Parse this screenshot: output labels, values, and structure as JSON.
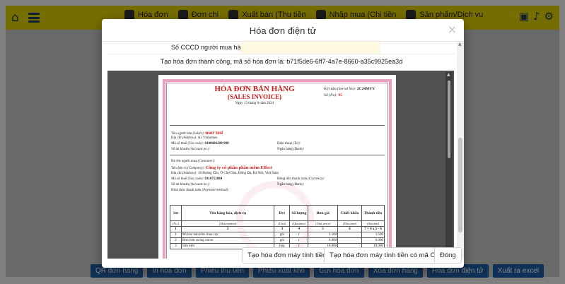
{
  "app": {
    "nav": [
      {
        "label": "Hóa đơn"
      },
      {
        "label": "Đơn chi"
      },
      {
        "label": "Xuất bán (Thu tiền"
      },
      {
        "label": "Nhập mua (Chi tiền"
      },
      {
        "label": "Sản phẩm/Dịch vụ"
      }
    ],
    "bottom_buttons": [
      "QR đơn hàng",
      "In hóa đơn",
      "Phiếu thu tiền",
      "Phiếu xuất kho",
      "Gửi hóa đơn",
      "Xóa đơn hàng",
      "Hóa đơn điện tử",
      "Xuất ra excel"
    ]
  },
  "modal": {
    "title": "Hóa đơn điện tử",
    "close": "×",
    "cccd_label": "Số CCCD người mua hàng",
    "cccd_value": "",
    "success_message": "Tạo hóa đơn thành công, mã số hóa đơn là: b71f5de6-6ff7-4a7e-8660-a35c9925ea3d",
    "buttons": {
      "create": "Tạo hóa đơn máy tính tiền",
      "create_cqt": "Tạo hóa đơn máy tính tiền có mã CQT",
      "close": "Đóng"
    }
  },
  "invoice": {
    "title": "HÓA ĐƠN BÁN HÀNG",
    "subtitle": "(SALES INVOICE)",
    "date": "Ngày 13 tháng 8 năm 2024",
    "serial_label": "Ký hiệu",
    "serial_label_en": "(Serial No):",
    "serial": "2C24MVY",
    "no_label": "Số",
    "no_label_en": "(No):",
    "no": "95",
    "seller": {
      "name_label": "Tên người bán",
      "name_label_en": "(Seller):",
      "name": "user test",
      "address_label": "Địa chỉ",
      "address_label_en": "(Address):",
      "address": "A3 Vinhomes",
      "tax_label": "Mã số thuế",
      "tax_label_en": "(Tax code):",
      "tax": "0100686209-998",
      "phone_label": "Điện thoại",
      "phone_label_en": "(Tel):",
      "account_label": "Số tài khoản",
      "account_label_en": "(Account no.):",
      "bank_label": "Ngân hàng",
      "bank_label_en": "(Bank):"
    },
    "buyer": {
      "customer_label": "Họ tên người mua",
      "customer_label_en": "(Customer):",
      "company_label": "Tên đơn vị",
      "company_label_en": "(Company):",
      "company": "Công ty cổ phần phần mềm Effect",
      "address_label": "Địa chỉ",
      "address_label_en": "(Address):",
      "address": "36 Hoàng Cầu, Ô Chợ Dừa, Đống Đa, Hà Nội, Việt Nam",
      "tax_label": "Mã số thuế",
      "tax_label_en": "(Tax code):",
      "tax": "0110752884",
      "currency_label": "Đồng tiền thanh toán",
      "currency_label_en": "(Currency):",
      "account_label": "Số tài khoản",
      "account_label_en": "(Account no.):",
      "bank_label": "Ngân hàng",
      "bank_label_en": "(Bank):",
      "payment_label": "Hình thức thanh toán",
      "payment_label_en": "(Payment method):"
    },
    "table": {
      "headers": [
        "Stt",
        "Tên hàng hóa, dịch vụ",
        "Đvt",
        "Số lượng",
        "Đơn giá",
        "Chiết khấu",
        "Thành tiền"
      ],
      "subheaders": [
        "(No.)",
        "(Description)",
        "(Unit)",
        "(Quantity)",
        "(Unit price)",
        "(Discount)",
        "(Amount)"
      ],
      "index_row": [
        "1",
        "2",
        "3",
        "4",
        "5",
        "6",
        "7 = 4 x 5 - 6"
      ],
      "rows": [
        [
          "1",
          "Mì hảo hảo tôm chua cay",
          "gói",
          "1",
          "3.500",
          "",
          "3.500"
        ],
        [
          "2",
          "Bim bim swing onion",
          "gói",
          "1",
          "6.000",
          "",
          "6.000"
        ],
        [
          "3",
          "Sữa tươi",
          "hộp",
          "1",
          "10.000",
          "",
          "10.000"
        ]
      ]
    }
  }
}
